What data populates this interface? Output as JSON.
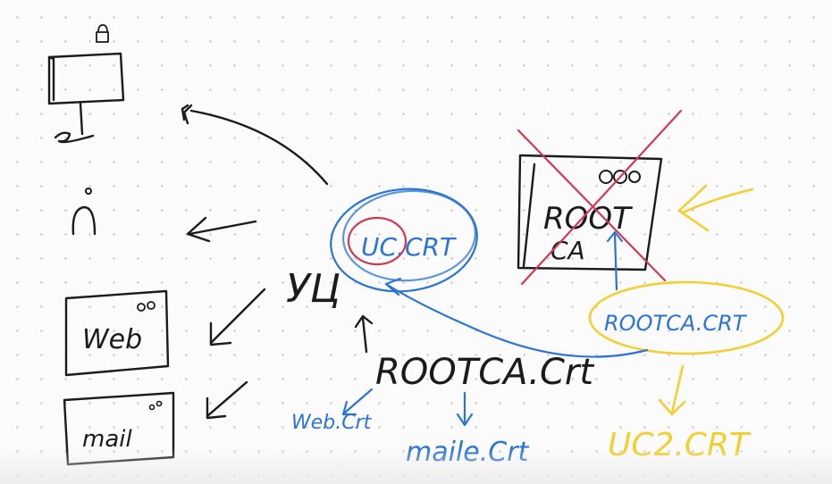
{
  "labels": {
    "root_box": "ROOT",
    "root_box_sub": "CA",
    "web_box": "Web",
    "mail_box": "mail",
    "uc_crt": "UC.CRT",
    "rootca_crt_blue": "ROOTCA.CRT",
    "rootca_crt_black": "ROOTCA.Crt",
    "web_crt": "Web.Crt",
    "mail_crt": "maile.Crt",
    "uc2_crt": "UC2.CRT",
    "uc_scribble": "УЦ"
  },
  "colors": {
    "ink": "#1b1b1b",
    "blue": "#2a74d6",
    "red": "#d23a52",
    "yellow": "#f2cf33",
    "dots": "#c9c9c9"
  },
  "icons": [
    "lock-icon",
    "monitor-icon",
    "person-icon"
  ]
}
